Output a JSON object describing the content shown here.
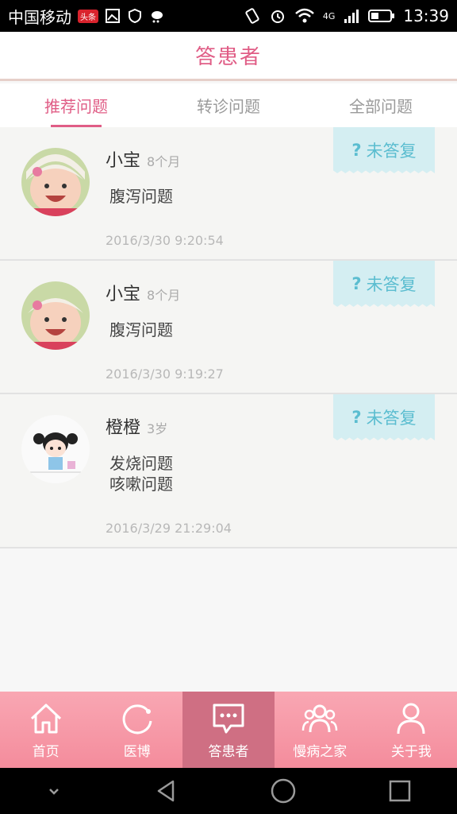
{
  "status_bar": {
    "carrier": "中国移动",
    "badge": "头条",
    "network": "4G",
    "time": "13:39"
  },
  "header": {
    "title": "答患者"
  },
  "tabs": [
    {
      "label": "推荐问题"
    },
    {
      "label": "转诊问题"
    },
    {
      "label": "全部问题"
    }
  ],
  "questions": [
    {
      "name": "小宝",
      "age": "8个月",
      "issues": [
        "腹泻问题"
      ],
      "time": "2016/3/30 9:20:54",
      "status": "未答复",
      "status_mark": "?"
    },
    {
      "name": "小宝",
      "age": "8个月",
      "issues": [
        "腹泻问题"
      ],
      "time": "2016/3/30 9:19:27",
      "status": "未答复",
      "status_mark": "?"
    },
    {
      "name": "橙橙",
      "age": "3岁",
      "issues": [
        "发烧问题",
        "咳嗽问题"
      ],
      "time": "2016/3/29 21:29:04",
      "status": "未答复",
      "status_mark": "?"
    }
  ],
  "bottom_nav": [
    {
      "label": "首页",
      "icon": "home-icon"
    },
    {
      "label": "医博",
      "icon": "refresh-icon"
    },
    {
      "label": "答患者",
      "icon": "chat-icon"
    },
    {
      "label": "慢病之家",
      "icon": "group-icon"
    },
    {
      "label": "关于我",
      "icon": "person-icon"
    }
  ],
  "colors": {
    "accent": "#e05d86",
    "tag_bg": "#d4eef2",
    "tag_text": "#5bbdd0",
    "nav_bg": "#f48c9c"
  }
}
